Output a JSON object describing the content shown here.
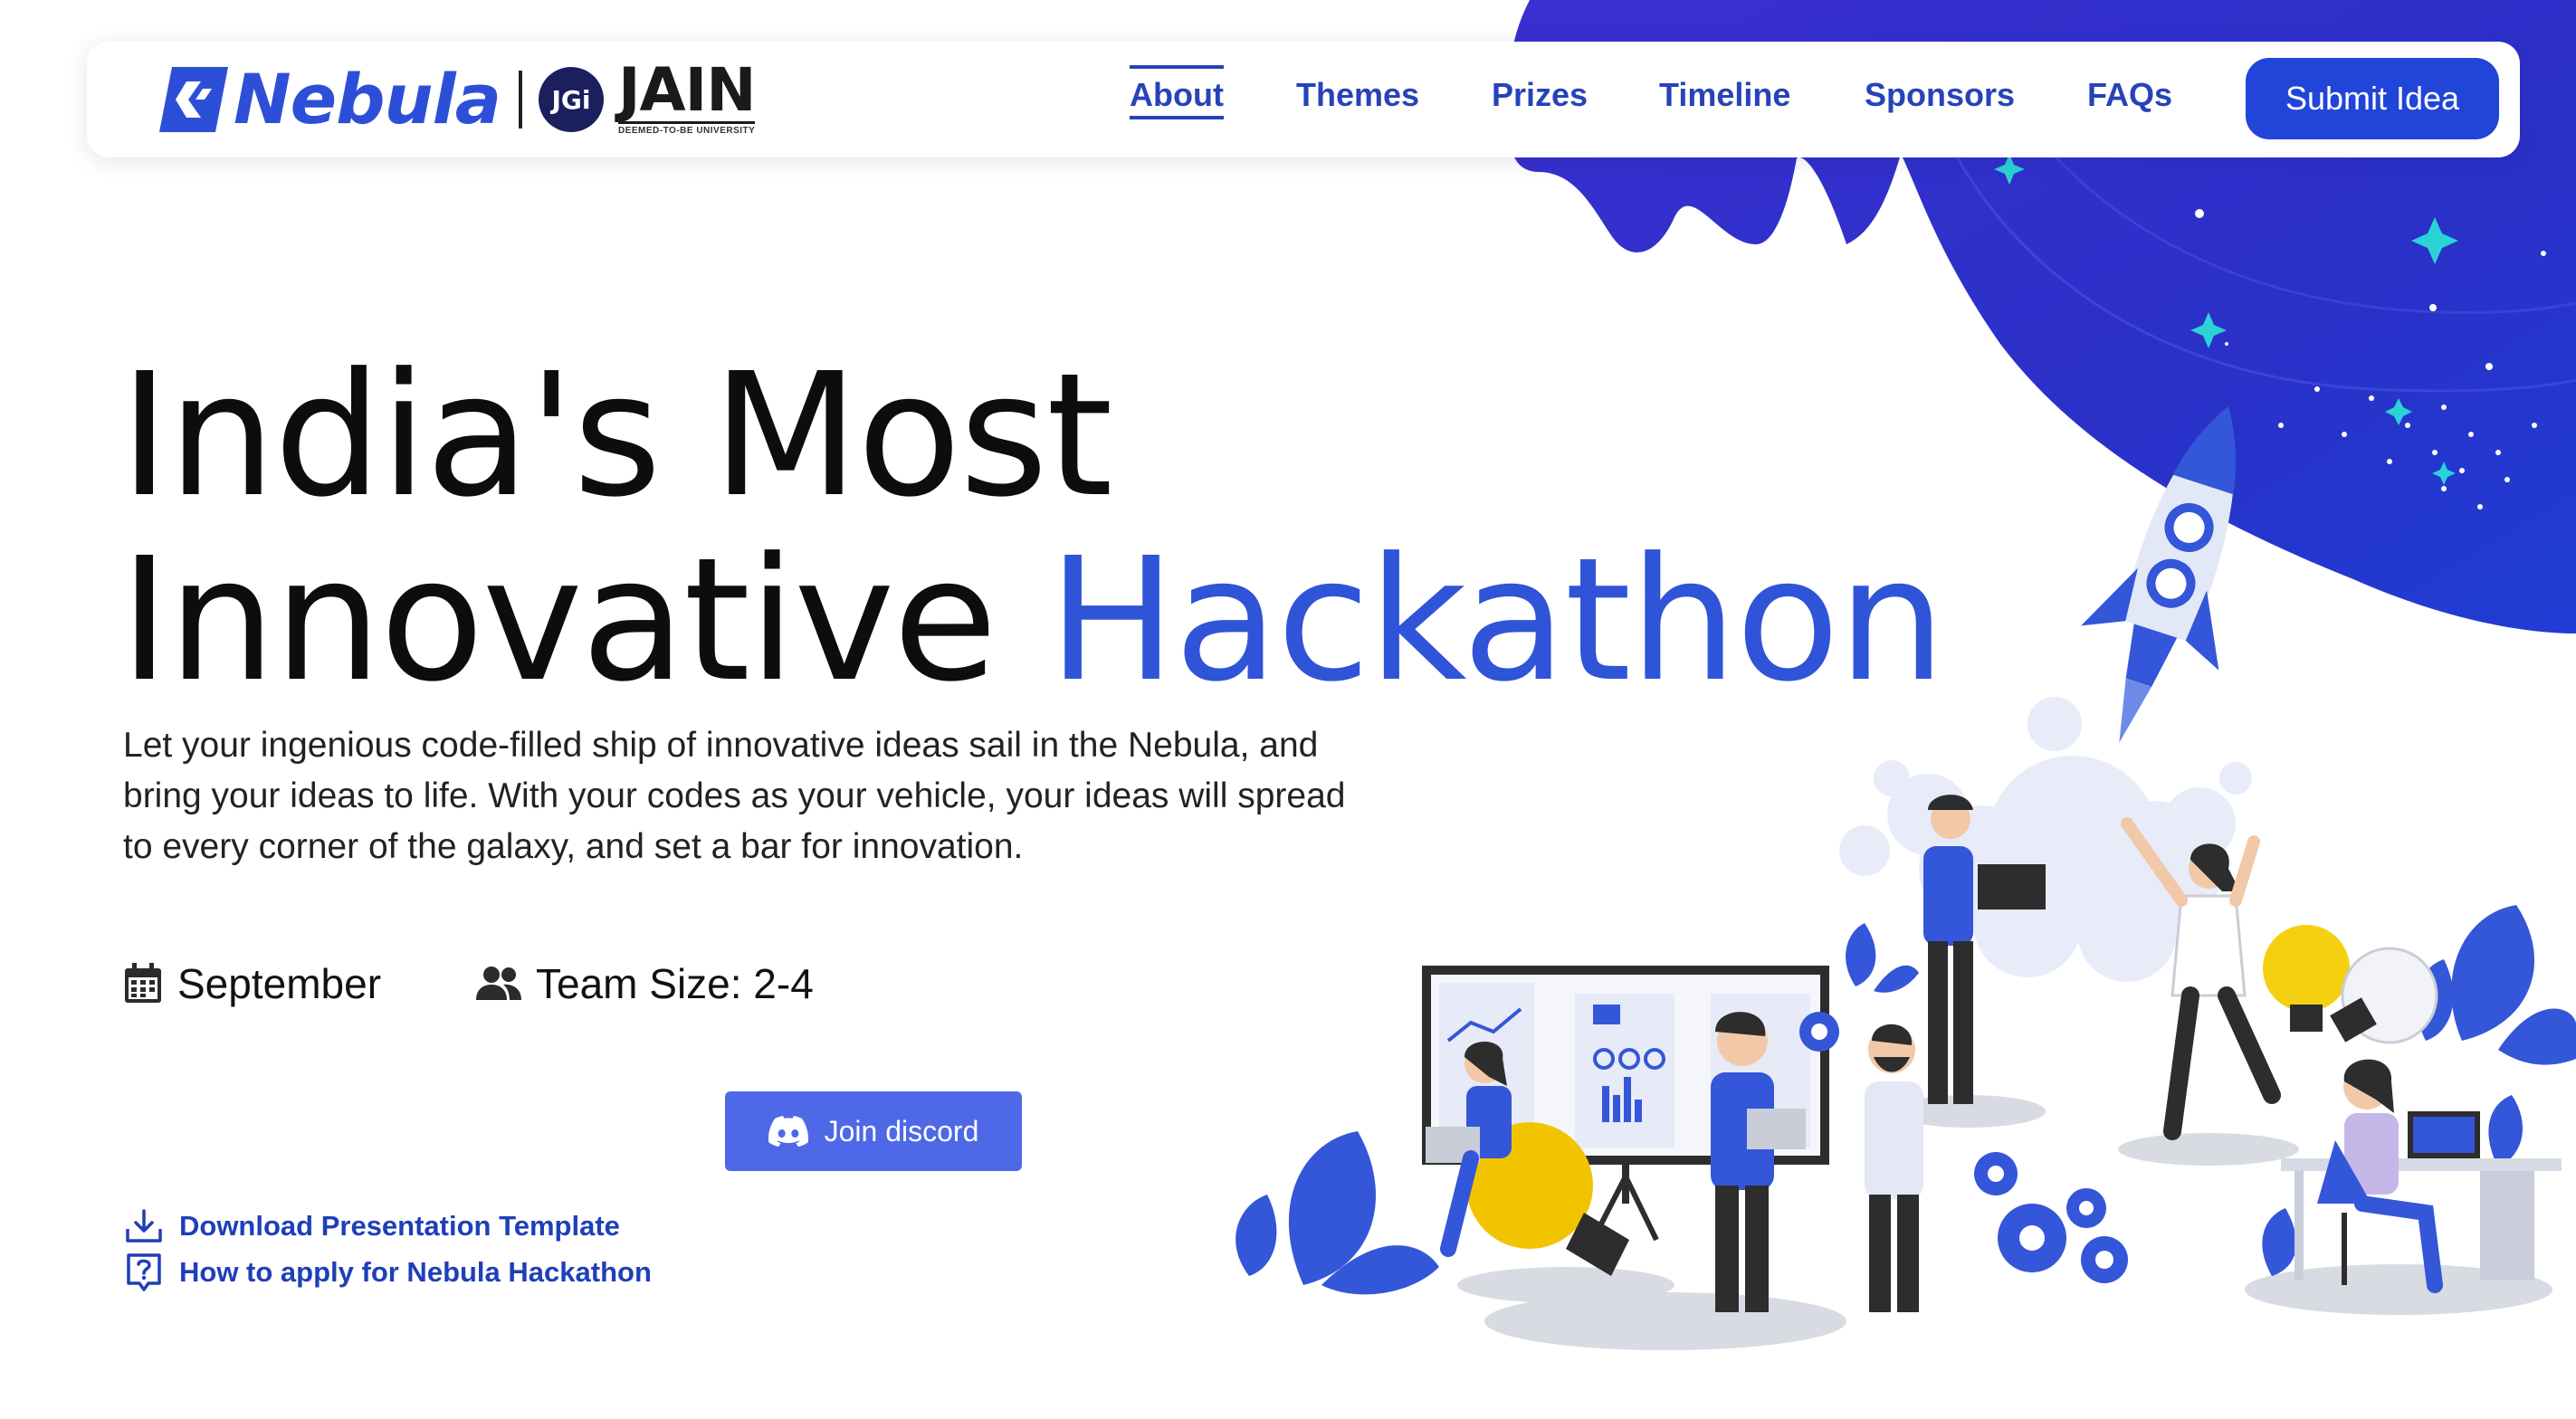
{
  "colors": {
    "accent": "#2f54d8",
    "nav_text": "#2643b8",
    "button": "#2145d8",
    "discord": "#4f68e8",
    "blob": "#2a33c8"
  },
  "brand": {
    "name": "Nebula",
    "partner_badge": "JGi",
    "partner_name": "JAIN",
    "partner_sub": "DEEMED-TO-BE UNIVERSITY"
  },
  "nav": {
    "items": [
      {
        "label": "About",
        "active": true
      },
      {
        "label": "Themes",
        "active": false
      },
      {
        "label": "Prizes",
        "active": false
      },
      {
        "label": "Timeline",
        "active": false
      },
      {
        "label": "Sponsors",
        "active": false
      },
      {
        "label": "FAQs",
        "active": false
      }
    ],
    "cta": "Submit Idea"
  },
  "hero": {
    "line1": "India's Most",
    "line2_plain": "Innovative ",
    "line2_accent": "Hackathon",
    "description": "Let your ingenious code-filled ship of innovative ideas sail in the Nebula, and bring your ideas to life. With your codes as your vehicle, your ideas will spread to every corner of the galaxy, and set a bar for innovation.",
    "date": "September",
    "team_size": "Team Size: 2-4",
    "discord_label": "Join discord",
    "links": [
      {
        "label": "Download Presentation Template",
        "icon": "download-icon"
      },
      {
        "label": "How to apply for Nebula Hackathon",
        "icon": "question-icon"
      }
    ]
  }
}
